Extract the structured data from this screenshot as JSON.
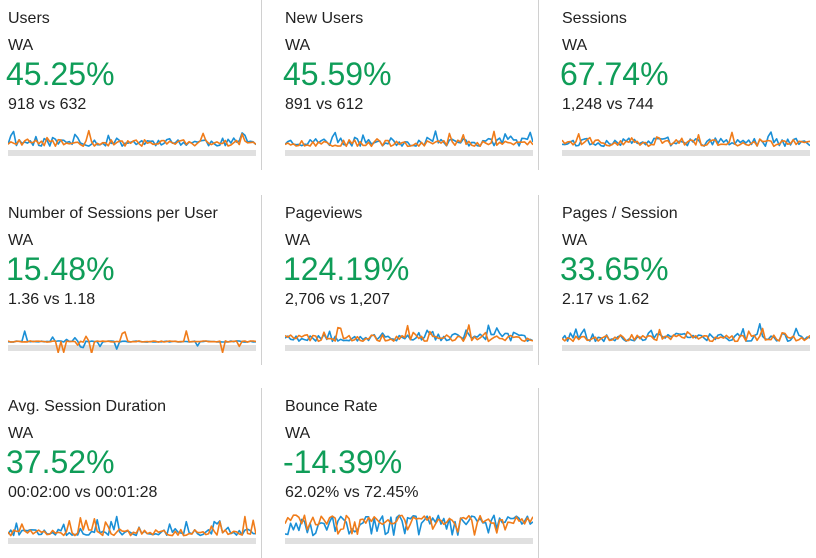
{
  "colors": {
    "positive": "#0f9d58",
    "series_current": "#1a8fd6",
    "series_previous": "#f07c1a",
    "baseline_fill": "#e0e0e0"
  },
  "metrics": [
    {
      "title": "Users",
      "segment": "WA",
      "change": "45.25%",
      "compare": "918 vs 632"
    },
    {
      "title": "New Users",
      "segment": "WA",
      "change": "45.59%",
      "compare": "891 vs 612"
    },
    {
      "title": "Sessions",
      "segment": "WA",
      "change": "67.74%",
      "compare": "1,248 vs 744"
    },
    {
      "title": "Number of Sessions per User",
      "segment": "WA",
      "change": "15.48%",
      "compare": "1.36 vs 1.18"
    },
    {
      "title": "Pageviews",
      "segment": "WA",
      "change": "124.19%",
      "compare": "2,706 vs 1,207"
    },
    {
      "title": "Pages / Session",
      "segment": "WA",
      "change": "33.65%",
      "compare": "2.17 vs 1.62"
    },
    {
      "title": "Avg. Session Duration",
      "segment": "WA",
      "change": "37.52%",
      "compare": "00:02:00 vs 00:01:28"
    },
    {
      "title": "Bounce Rate",
      "segment": "WA",
      "change": "-14.39%",
      "compare": "62.02% vs 72.45%"
    }
  ]
}
